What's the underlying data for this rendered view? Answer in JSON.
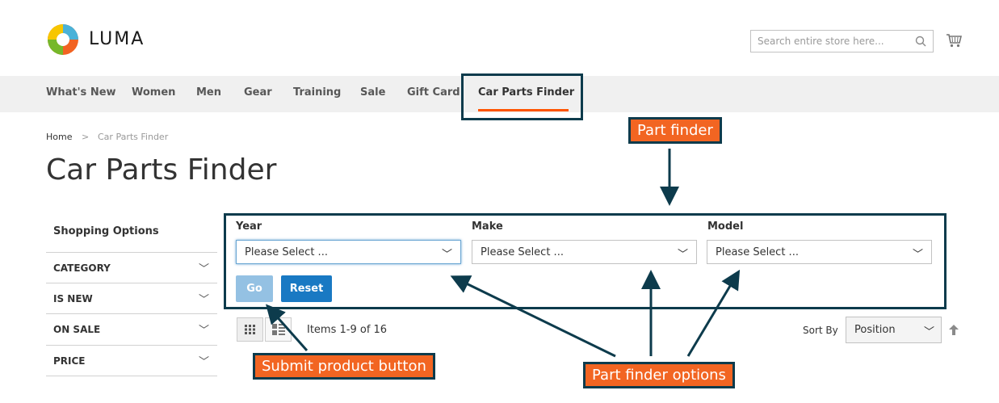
{
  "header": {
    "logo_text": "LUMA",
    "search": {
      "placeholder": "Search entire store here...",
      "value": ""
    }
  },
  "nav": {
    "items": [
      "What's New",
      "Women",
      "Men",
      "Gear",
      "Training",
      "Sale",
      "Gift Card",
      "Car Parts Finder"
    ],
    "active": "Car Parts Finder",
    "accent_color": "#ff5501"
  },
  "breadcrumb": {
    "home": "Home",
    "separator": ">",
    "current": "Car Parts Finder"
  },
  "page": {
    "title": "Car Parts Finder"
  },
  "sidebar": {
    "heading": "Shopping Options",
    "filters": [
      "CATEGORY",
      "IS NEW",
      "ON SALE",
      "PRICE"
    ]
  },
  "finder": {
    "fields": [
      {
        "label": "Year",
        "selected": "Please Select ..."
      },
      {
        "label": "Make",
        "selected": "Please Select ..."
      },
      {
        "label": "Model",
        "selected": "Please Select ..."
      }
    ],
    "go_label": "Go",
    "reset_label": "Reset",
    "go_color": "#94c1e3",
    "reset_color": "#1979c3"
  },
  "toolbar": {
    "items_text": "Items 1-9 of 16",
    "sort_by_label": "Sort By",
    "sort_value": "Position"
  },
  "annotations": {
    "part_finder": "Part finder",
    "submit_button": "Submit product button",
    "finder_options": "Part finder options",
    "callout_color": "#f26522",
    "frame_color": "#0d3b4c"
  }
}
